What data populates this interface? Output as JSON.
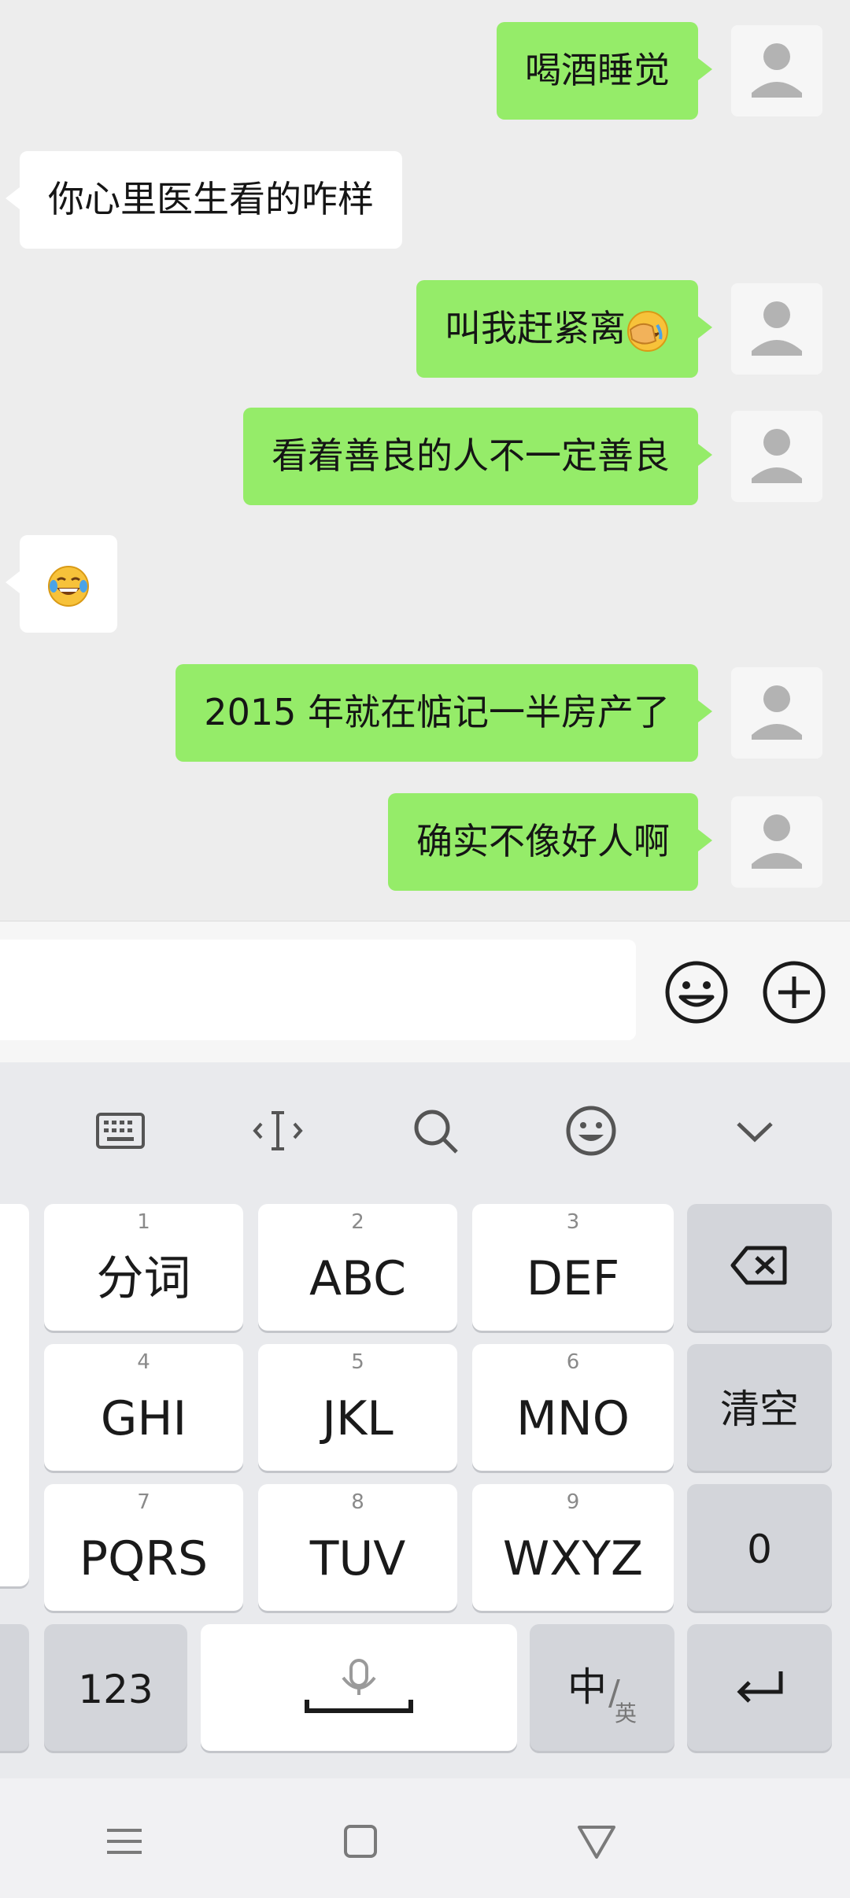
{
  "messages": [
    {
      "side": "out",
      "text": "喝酒睡觉"
    },
    {
      "side": "in",
      "text": "你心里医生看的咋样"
    },
    {
      "side": "out",
      "text": "叫我赶紧离",
      "emoji": "facepalm-emoji"
    },
    {
      "side": "out",
      "text": "看着善良的人不一定善良"
    },
    {
      "side": "in",
      "text": "",
      "emoji": "tears-of-joy-emoji"
    },
    {
      "side": "out",
      "text": "2015 年就在惦记一半房产了"
    },
    {
      "side": "out",
      "text": "确实不像好人啊"
    }
  ],
  "input": {
    "placeholder": ""
  },
  "keyboard": {
    "toolbar": [
      "keyboard-icon",
      "cursor-icon",
      "search-icon",
      "emoji-icon",
      "chevron-down-icon"
    ],
    "rows": [
      [
        {
          "num": "1",
          "label": "分词"
        },
        {
          "num": "2",
          "label": "ABC"
        },
        {
          "num": "3",
          "label": "DEF"
        }
      ],
      [
        {
          "num": "4",
          "label": "GHI"
        },
        {
          "num": "5",
          "label": "JKL"
        },
        {
          "num": "6",
          "label": "MNO"
        }
      ],
      [
        {
          "num": "7",
          "label": "PQRS"
        },
        {
          "num": "8",
          "label": "TUV"
        },
        {
          "num": "9",
          "label": "WXYZ"
        }
      ]
    ],
    "side_keys": {
      "clear": "清空",
      "zero": "0",
      "backspace": "backspace-icon"
    },
    "bottom": {
      "num_key": "123",
      "lang_main": "中",
      "lang_sub": "英",
      "space": "mic-icon",
      "enter": "enter-icon"
    }
  },
  "colors": {
    "outgoing_bubble": "#95ec69",
    "incoming_bubble": "#ffffff",
    "chat_bg": "#ededed"
  }
}
